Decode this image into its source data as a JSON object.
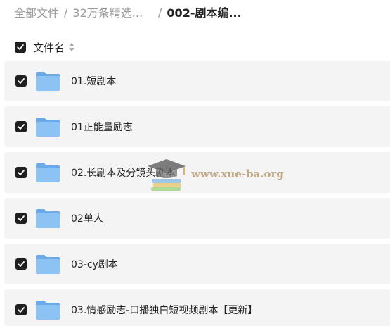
{
  "breadcrumb": {
    "items": [
      "全部文件",
      "32万条精选...",
      "002-剧本编..."
    ],
    "separator": "/"
  },
  "header": {
    "column_label": "文件名",
    "checkbox_checked": true
  },
  "files": [
    {
      "name": "01.短剧本",
      "type": "folder",
      "checked": true
    },
    {
      "name": "01正能量励志",
      "type": "folder",
      "checked": true
    },
    {
      "name": "02.长剧本及分镜头剧本",
      "type": "folder",
      "checked": true
    },
    {
      "name": "02单人",
      "type": "folder",
      "checked": true
    },
    {
      "name": "03-cy剧本",
      "type": "folder",
      "checked": true
    },
    {
      "name": "03.情感励志-口播独白短视频剧本【更新】",
      "type": "folder",
      "checked": true
    }
  ],
  "watermark": {
    "text": "www.xue-ba.org",
    "icon": "graduation-cap-books-icon"
  },
  "colors": {
    "checkbox": "#1f1f1f",
    "row_bg": "#f4f4f4",
    "folder": "#7fb8f0",
    "crumb_muted": "#999999"
  }
}
